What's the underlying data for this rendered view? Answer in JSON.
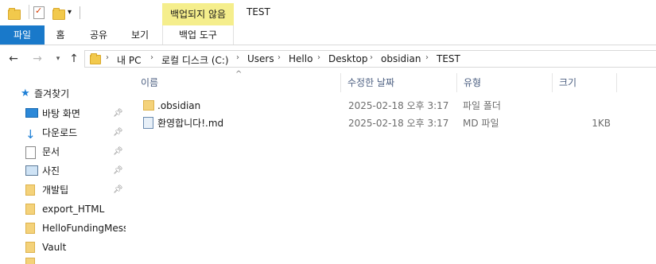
{
  "window": {
    "title": "TEST",
    "context_tab_group": "백업되지 않음"
  },
  "ribbon": {
    "tabs": [
      "파일",
      "홈",
      "공유",
      "보기",
      "백업 도구"
    ]
  },
  "address": {
    "crumbs": [
      "내 PC",
      "로컬 디스크 (C:)",
      "Users",
      "Hello",
      "Desktop",
      "obsidian",
      "TEST"
    ]
  },
  "nav": {
    "items": [
      {
        "label": "즐겨찾기",
        "icon": "star-icon"
      },
      {
        "label": "바탕 화면",
        "icon": "desktop-icon",
        "pinned": true
      },
      {
        "label": "다운로드",
        "icon": "download-arrow-icon",
        "pinned": true
      },
      {
        "label": "문서",
        "icon": "document-icon",
        "pinned": true
      },
      {
        "label": "사진",
        "icon": "picture-icon",
        "pinned": true
      },
      {
        "label": "개발팁",
        "icon": "folder-icon",
        "pinned": true
      },
      {
        "label": "export_HTML",
        "icon": "folder-icon"
      },
      {
        "label": "HelloFundingMesse",
        "icon": "folder-icon"
      },
      {
        "label": "Vault",
        "icon": "folder-icon"
      }
    ]
  },
  "columns": {
    "name": "이름",
    "modified": "수정한 날짜",
    "type": "유형",
    "size": "크기"
  },
  "files": [
    {
      "name": ".obsidian",
      "modified": "2025-02-18 오후 3:17",
      "type": "파일 폴더",
      "size": "",
      "icon": "folder-icon"
    },
    {
      "name": "환영합니다!.md",
      "modified": "2025-02-18 오후 3:17",
      "type": "MD 파일",
      "size": "1KB",
      "icon": "text-file-icon"
    }
  ],
  "colors": {
    "file_tab": "#1979ca",
    "context_tab": "#f5ee8c",
    "folder": "#f4d27a"
  }
}
